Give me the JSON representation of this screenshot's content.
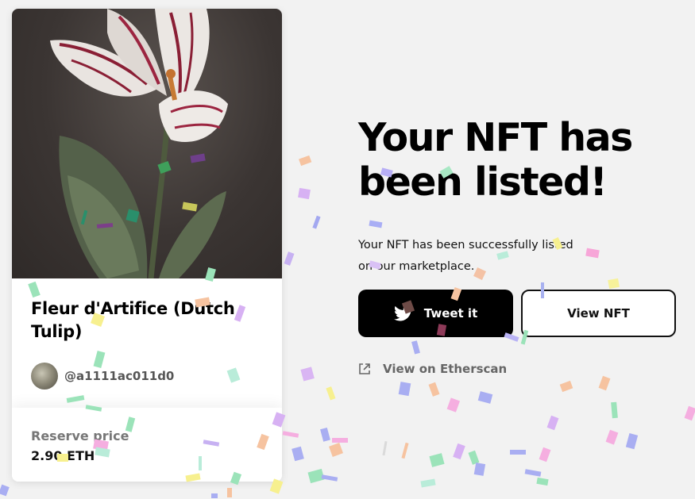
{
  "nft": {
    "title": "Fleur d'Artifice (Dutch Tulip)",
    "creator": "@a1111ac011d0",
    "reserve_label": "Reserve price",
    "reserve_value": "2.90 ETH"
  },
  "main": {
    "headline": "Your NFT has been listed!",
    "subtext": "Your NFT has been successfully listed on our marketplace.",
    "tweet_label": "Tweet it",
    "view_label": "View NFT",
    "etherscan_label": "View on Etherscan"
  },
  "colors": {
    "background": "#f2f2f2",
    "primary_button": "#000000",
    "secondary_button_border": "#111111"
  },
  "icons": {
    "tweet": "twitter-bird-icon",
    "etherscan": "external-link-icon"
  }
}
